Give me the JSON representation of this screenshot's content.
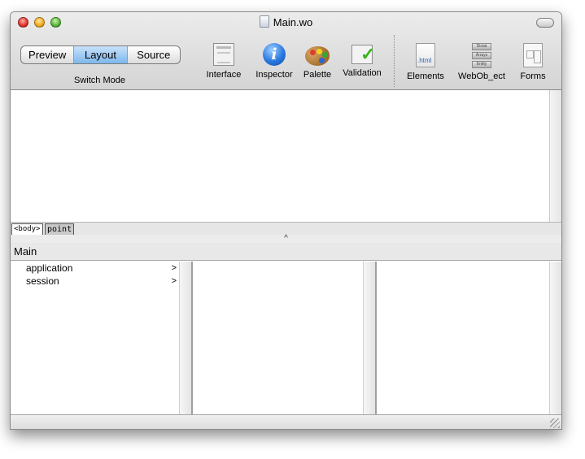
{
  "window": {
    "title": "Main.wo"
  },
  "mode_switch": {
    "buttons": [
      {
        "label": "Preview"
      },
      {
        "label": "Layout",
        "active": true
      },
      {
        "label": "Source"
      }
    ],
    "caption": "Switch Mode"
  },
  "toolbar": {
    "interface": {
      "label": "Interface",
      "icon": "interface-icon"
    },
    "inspector": {
      "label": "Inspector",
      "icon": "info-icon",
      "glyph": "i"
    },
    "palette": {
      "label": "Palette",
      "icon": "palette-icon"
    },
    "validation": {
      "label": "Validation",
      "icon": "validation-icon"
    },
    "elements": {
      "label": "Elements",
      "icon": "html-file-icon",
      "glyph": ".html"
    },
    "webobject": {
      "label": "WebOb_ect",
      "icon": "webobject-icon",
      "stack": [
        "Dictat",
        "Arrays",
        "Entity"
      ]
    },
    "forms": {
      "label": "Forms",
      "icon": "forms-icon"
    }
  },
  "path_bar": {
    "tags": [
      "<body>",
      "point"
    ]
  },
  "splitter": {
    "glyph": "^"
  },
  "browser": {
    "header": "Main",
    "columns": [
      {
        "items": [
          {
            "label": "application",
            "arrow": ">"
          },
          {
            "label": "session",
            "arrow": ">"
          }
        ]
      },
      {
        "items": []
      },
      {
        "items": []
      }
    ]
  },
  "colors": {
    "active_segment": "#7db7ec",
    "inspector_blue": "#2a78e0",
    "check_green": "#3bb31b"
  }
}
